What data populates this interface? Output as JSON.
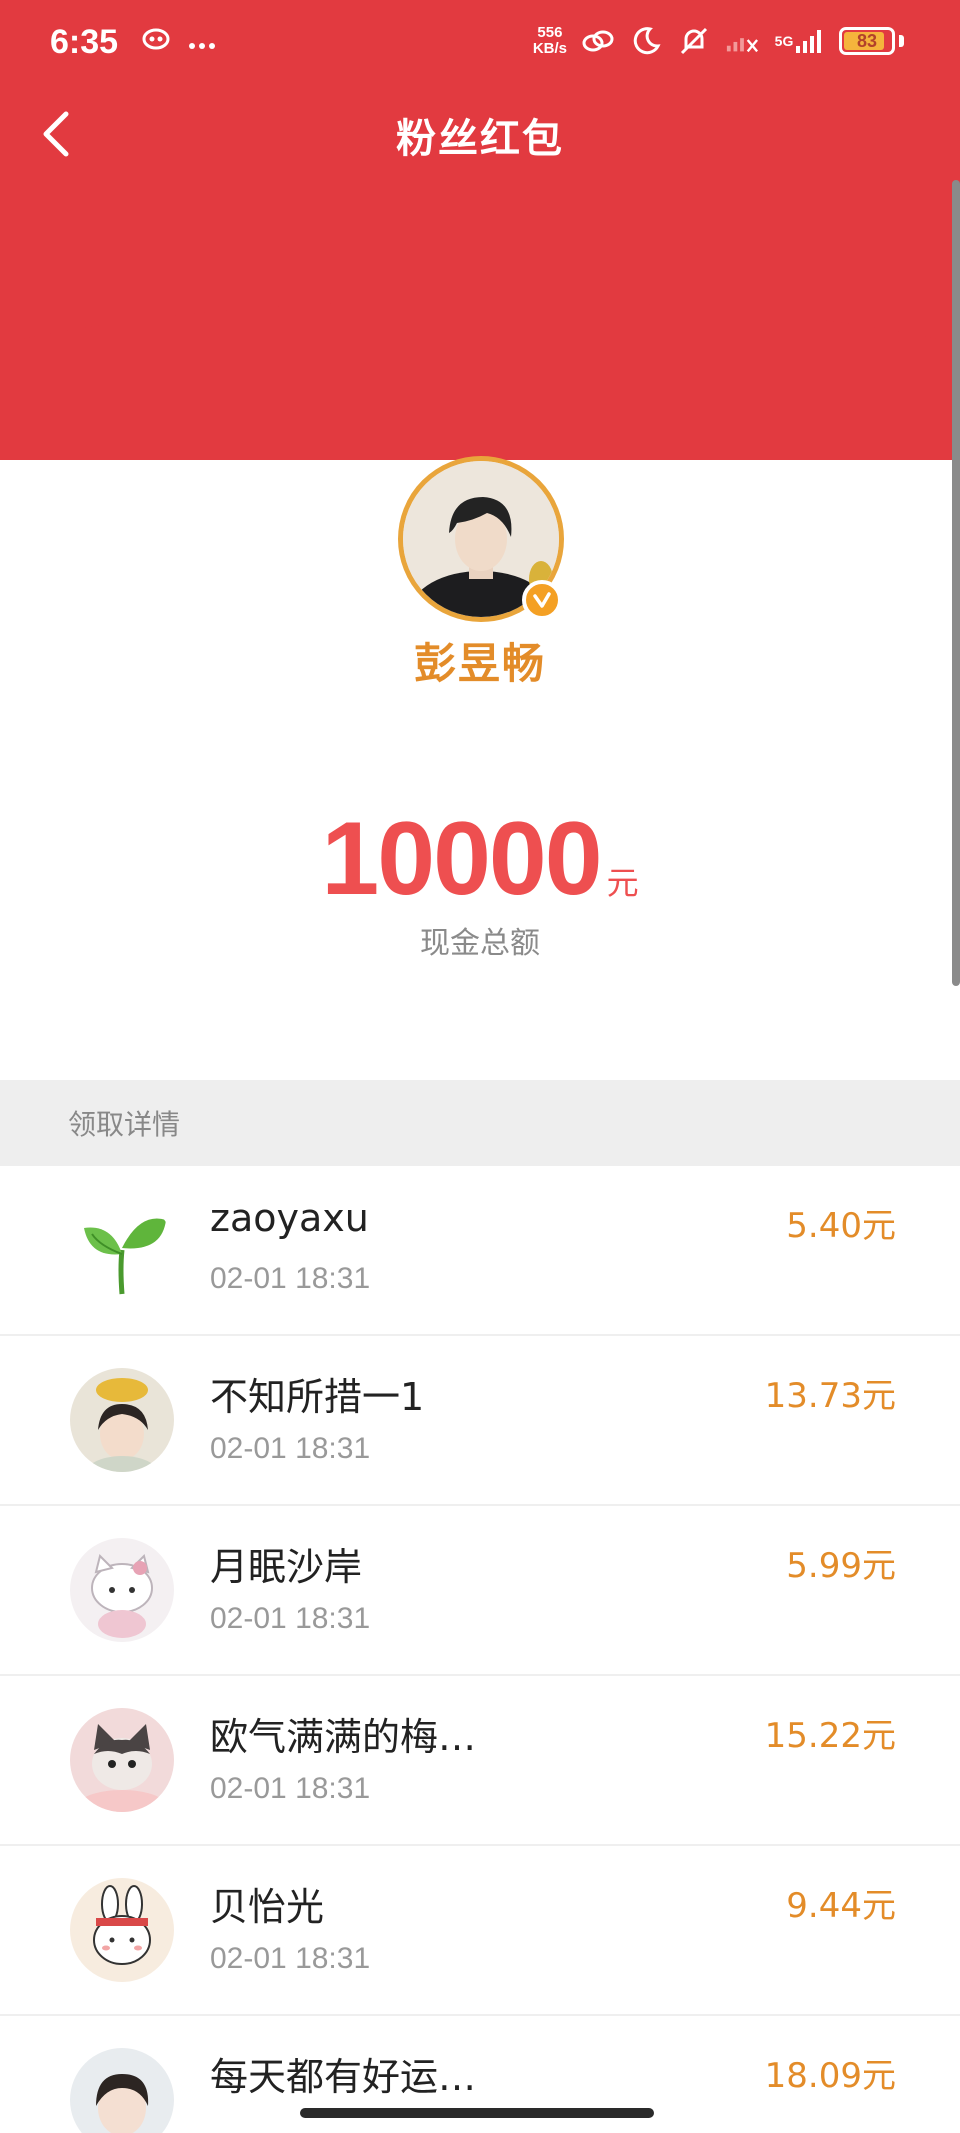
{
  "status_bar": {
    "time": "6:35",
    "net_speed_value": "556",
    "net_speed_unit": "KB/s",
    "network": "5G",
    "battery": "83"
  },
  "header": {
    "back_icon": "chevron-left-icon",
    "title": "粉丝红包"
  },
  "creator": {
    "name": "彭昱畅",
    "verified_icon": "verified-badge-icon"
  },
  "summary": {
    "amount": "10000",
    "unit": "元",
    "caption": "现金总额"
  },
  "section": {
    "title": "领取详情"
  },
  "claims": [
    {
      "name": "zaoyaxu",
      "time": "02-01 18:31",
      "amount": "5.40元",
      "avatar": "sprout-avatar"
    },
    {
      "name": "不知所措一1",
      "time": "02-01 18:31",
      "amount": "13.73元",
      "avatar": "girl-with-gold-ingot-avatar"
    },
    {
      "name": "月眠沙岸",
      "time": "02-01 18:31",
      "amount": "5.99元",
      "avatar": "hello-kitty-avatar"
    },
    {
      "name": "欧气满满的梅…",
      "time": "02-01 18:31",
      "amount": "15.22元",
      "avatar": "kitten-avatar"
    },
    {
      "name": "贝怡光",
      "time": "02-01 18:31",
      "amount": "9.44元",
      "avatar": "bunny-avatar"
    },
    {
      "name": "每天都有好运…",
      "time": "",
      "amount": "18.09元",
      "avatar": "girl-portrait-avatar"
    }
  ],
  "colors": {
    "brand_red": "#e23a40",
    "amount_red": "#ee4f50",
    "gold": "#e38c29"
  }
}
